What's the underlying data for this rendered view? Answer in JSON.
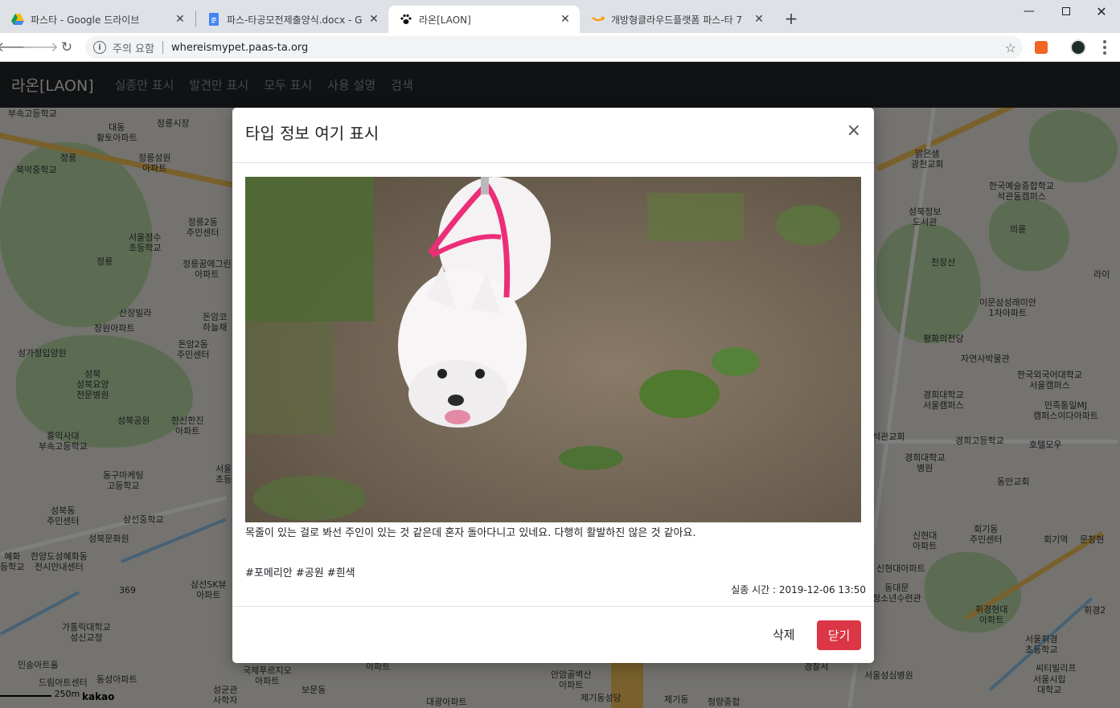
{
  "browser": {
    "tabs": [
      {
        "title": "파스타 - Google 드라이브",
        "favicon": "google-drive-icon",
        "active": false
      },
      {
        "title": "파스-타공모전제출양식.docx - G",
        "favicon": "google-docs-icon",
        "active": false
      },
      {
        "title": "라온[LAON]",
        "favicon": "paw-icon",
        "active": true
      },
      {
        "title": "개방형클라우드플랫폼 파스-타 7",
        "favicon": "amazon-icon",
        "active": false
      }
    ],
    "security_label": "주의 요함",
    "url": "whereismypet.paas-ta.org"
  },
  "navbar": {
    "brand": "라온[LAON]",
    "links": [
      "실종만 표시",
      "발견만 표시",
      "모두 표시",
      "사용 설명",
      "검색"
    ]
  },
  "map": {
    "labels": [
      "부속고등학교",
      "대동\n황토아파트",
      "정릉시장",
      "정릉",
      "정릉성원\n아파트",
      "북악중학교",
      "정릉2동\n주민센터",
      "서울정수\n초등학교",
      "정릉",
      "정릉꿈에그린\n아파트",
      "산장빌라",
      "장원아파트",
      "돈암코\n하늘채",
      "성가정입양원",
      "성북\n성북요양\n전문병원",
      "돈암2동\n주민센터",
      "성북공원",
      "한신한진\n아파트",
      "홍익사대\n부속고등학교",
      "동구마케팅\n고등학교",
      "서울\n초등",
      "성북동\n주민센터",
      "삼선중학교",
      "성북문화원",
      "한양도성혜화동\n전시안내센터",
      "삼선SK뷰\n아파트",
      "369",
      "가톨릭대학교\n성신교정",
      "민송아트홀",
      "동성아파트",
      "드림아트센터",
      "성균관\n사학자",
      "맑은샘\n광천교회",
      "한국예술종합학교\n석관동캠퍼스",
      "성북정보\n도서관",
      "의릉",
      "천장산",
      "이문삼성래미안\n1차아파트",
      "평화의전당",
      "자연사박물관",
      "한국외국어대학교\n서울캠퍼스",
      "경희대학교\n서울캠퍼스",
      "민족통일MJ\n캠퍼스이다아파트",
      "경희고등학교",
      "호텔모우",
      "경희대학교\n병원",
      "동안교회",
      "신현대\n아파트",
      "회기동\n주민센터",
      "회기역",
      "문창현",
      "신현대아파트",
      "동대문\n청소년수련관",
      "휘경현대\n아파트",
      "서울휘경\n초등학교",
      "씨티빌리프",
      "서울성심병원",
      "서울시립\n대학교",
      "라이",
      "석관교회",
      "휘경2",
      "혜화\n등학교",
      "국제푸르지오\n아파트",
      "안암골벽산\n아파트",
      "제기동성당",
      "제기동",
      "대광아파트",
      "청량종합",
      "경찰서",
      "아파트",
      "보문동"
    ],
    "scale": "250m",
    "provider": "kakao"
  },
  "modal": {
    "title": "타입 정보 여기 표시",
    "close_glyph": "×",
    "photo_alt": "분홍색 하네스를 찬 흰색 포메라니안",
    "description": "목줄이 있는 걸로 봐선 주인이 있는 것 같은데 혼자 돌아다니고 있네요. 다행히 활발하진 않은 것 같아요.",
    "tags": "#포메리안 #공원 #흰색",
    "lost_time": "실종 시간 : 2019-12-06 13:50",
    "delete_label": "삭제",
    "close_label": "닫기"
  },
  "colors": {
    "navbar": "#202428",
    "danger": "#dc3545"
  }
}
